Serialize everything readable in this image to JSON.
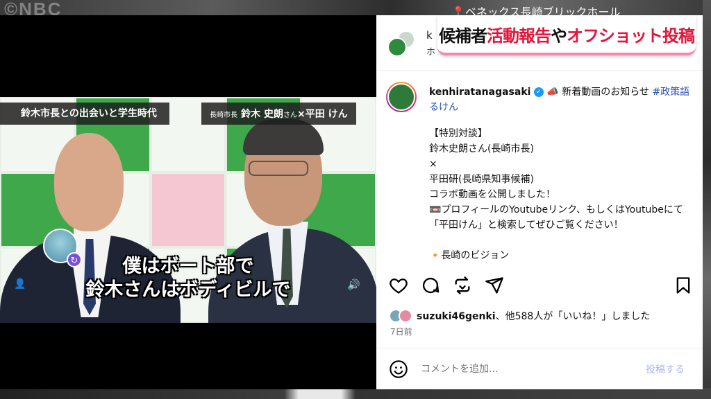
{
  "background": {
    "watermark": "©NBC",
    "venue": "📍ベネックス長崎ブリックホール"
  },
  "banner": {
    "part1": "候補者 ",
    "part2": "活動報告",
    "part3": "や",
    "part4": "オフショット投稿",
    "accent_color": "#e5133a"
  },
  "video": {
    "caption_left": "鈴木市長との出会いと学生時代",
    "caption_right_title": "長崎市長",
    "caption_right_name1": "鈴木 史朗",
    "caption_right_suffix": "さん",
    "caption_right_x": "×",
    "caption_right_name2": "平田 けん",
    "subtitle_line1": "僕はボート部で",
    "subtitle_line2": "鈴木さんはボディビルで",
    "icons": [
      "user-icon",
      "speaker-icon",
      "repost-badge-icon"
    ]
  },
  "post": {
    "top_partial_1": "k",
    "top_partial_2": "ホ",
    "handle": "kenhiratanagasaki",
    "headline": " 新着動画のお知らせ ",
    "hashtag": "#政策語るけん",
    "caption": "【特別対談】\n鈴木史朗さん(長崎市長)\n×\n平田研(長崎県知事候補)\nコラボ動画を公開しました！\n📼プロフィールのYoutubeリンク、もしくはYoutubeにて「平田けん」と検索してぜひご覧ください！\n\n🔸長崎のビジョン",
    "liked_by": "suzuki46genki",
    "likes_rest": "、他588人が「いいね！」しました",
    "date": "7日前",
    "comment_placeholder": "コメントを追加...",
    "post_button": "投稿する",
    "icons": [
      "heart-icon",
      "comment-icon",
      "repost-icon",
      "share-icon",
      "bookmark-icon",
      "emoji-icon",
      "verified-icon",
      "megaphone-icon"
    ]
  }
}
